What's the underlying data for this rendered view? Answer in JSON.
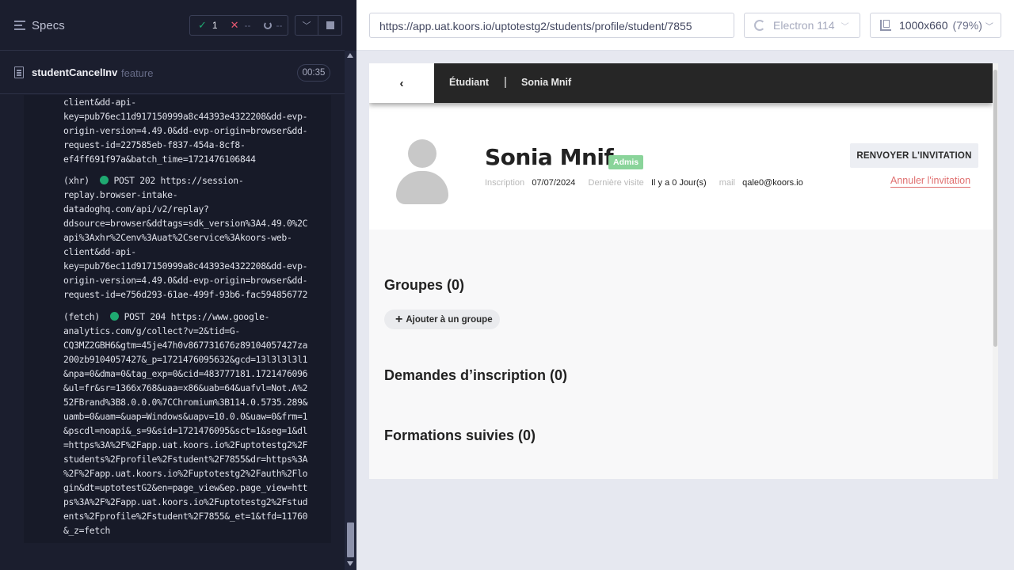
{
  "runner": {
    "specs_label": "Specs",
    "stats": {
      "passed": "1",
      "failed": "--",
      "pending": "--"
    },
    "spec": {
      "name": "studentCancelInv",
      "kind": "feature",
      "duration": "00:35"
    },
    "log_lines": [
      "client&dd-api-",
      "key=pub76ec11d917150999a8c44393e4322208&dd-evp-",
      "origin-version=4.49.0&dd-evp-origin=browser&dd-",
      "request-id=227585eb-f837-454a-8cf8-",
      "ef4ff691f97a&batch_time=1721476106844",
      "(xhr)  ",
      "POST 202 https://session-",
      "replay.browser-intake-",
      "datadoghq.com/api/v2/replay?",
      "ddsource=browser&ddtags=sdk_version%3A4.49.0%2C",
      "api%3Axhr%2Cenv%3Auat%2Cservice%3Akoors-web-",
      "client&dd-api-",
      "key=pub76ec11d917150999a8c44393e4322208&dd-evp-",
      "origin-version=4.49.0&dd-evp-origin=browser&dd-",
      "request-id=e756d293-61ae-499f-93b6-fac594856772",
      "(fetch)  ",
      "POST 204 https://www.google-",
      "analytics.com/g/collect?v=2&tid=G-",
      "CQ3MZ2GBH6&gtm=45je47h0v867731676z89104057427za",
      "200zb9104057427&_p=1721476095632&gcd=13l3l3l3l1",
      "&npa=0&dma=0&tag_exp=0&cid=483777181.1721476096",
      "&ul=fr&sr=1366x768&uaa=x86&uab=64&uafvl=Not.A%2",
      "52FBrand%3B8.0.0.0%7CChromium%3B114.0.5735.289&",
      "uamb=0&uam=&uap=Windows&uapv=10.0.0&uaw=0&frm=1",
      "&pscdl=noapi&_s=9&sid=1721476095&sct=1&seg=1&dl",
      "=https%3A%2F%2Fapp.uat.koors.io%2Fuptotestg2%2F",
      "students%2Fprofile%2Fstudent%2F7855&dr=https%3A",
      "%2F%2Fapp.uat.koors.io%2Fuptotestg2%2Fauth%2Flo",
      "gin&dt=uptotestG2&en=page_view&ep.page_view=htt",
      "ps%3A%2F%2Fapp.uat.koors.io%2Fuptotestg2%2Fstud",
      "ents%2Fprofile%2Fstudent%2F7855&_et=1&tfd=11760",
      "&_z=fetch"
    ]
  },
  "browser_bar": {
    "url": "https://app.uat.koors.io/uptotestg2/students/profile/student/7855",
    "browser": "Electron 114",
    "viewport": "1000x660",
    "zoom": "(79%)"
  },
  "app": {
    "breadcrumb": {
      "section": "Étudiant",
      "separator": "|",
      "current": "Sonia Mnif"
    },
    "student": {
      "name": "Sonia Mnif",
      "badge": "Admis",
      "inscription_label": "Inscription",
      "inscription_value": "07/07/2024",
      "last_visit_label": "Dernière visite",
      "last_visit_value": "Il y a 0 Jour(s)",
      "mail_label": "mail",
      "mail_value": "qale0@koors.io"
    },
    "actions": {
      "resend": "RENVOYER L'INVITATION",
      "cancel": "Annuler l'invitation"
    },
    "sections": {
      "groups": "Groupes (0)",
      "add_group": "Ajouter à un groupe",
      "requests": "Demandes d’inscription (0)",
      "trainings": "Formations suivies (0)"
    }
  }
}
